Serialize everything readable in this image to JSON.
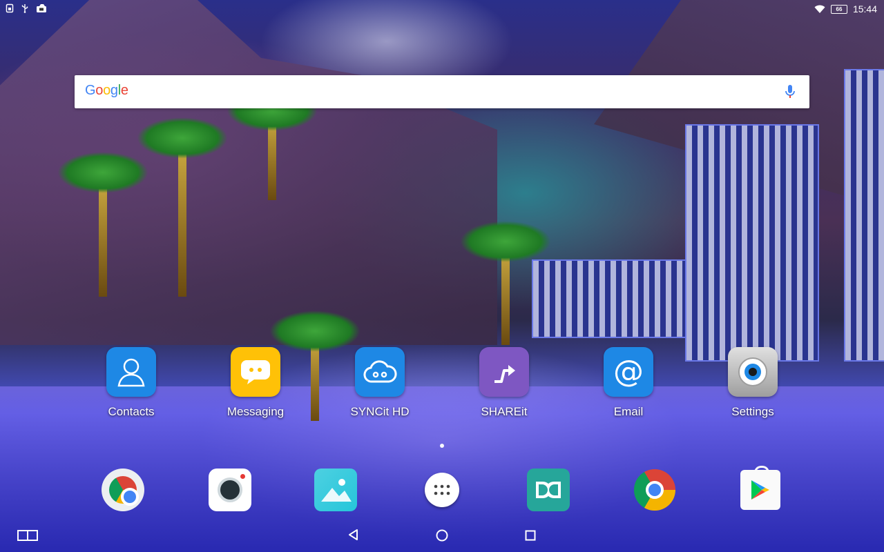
{
  "status_bar": {
    "time": "15:44",
    "battery": "66",
    "icons": [
      "sim-icon",
      "usb-icon",
      "screenshot-icon",
      "wifi-icon",
      "battery-icon"
    ]
  },
  "search": {
    "logo_text": "Google",
    "colors": [
      "#4285F4",
      "#EA4335",
      "#FBBC05",
      "#4285F4",
      "#34A853",
      "#EA4335"
    ],
    "mic_icon": "mic-icon"
  },
  "home": {
    "apps": [
      {
        "label": "Contacts",
        "icon": "contacts-icon",
        "color": "#1e88e5"
      },
      {
        "label": "Messaging",
        "icon": "messaging-icon",
        "color": "#ffc107"
      },
      {
        "label": "SYNCit HD",
        "icon": "cloud-sync-icon",
        "color": "#1e88e5"
      },
      {
        "label": "SHAREit",
        "icon": "shareit-icon",
        "color": "#7e57c2"
      },
      {
        "label": "Email",
        "icon": "at-sign-icon",
        "color": "#1e88e5"
      },
      {
        "label": "Settings",
        "icon": "gear-icon",
        "color": "#bdbdbd"
      }
    ],
    "page_indicator": {
      "pages": 2,
      "current": 1
    }
  },
  "dock": {
    "apps": [
      {
        "name": "chrome-folder",
        "icon": "chrome-icon"
      },
      {
        "name": "camera",
        "icon": "camera-icon"
      },
      {
        "name": "gallery",
        "icon": "gallery-icon"
      },
      {
        "name": "app-drawer",
        "icon": "app-drawer-icon"
      },
      {
        "name": "dolby",
        "icon": "dolby-icon"
      },
      {
        "name": "chrome",
        "icon": "chrome-icon"
      },
      {
        "name": "play-store",
        "icon": "play-store-icon"
      }
    ]
  },
  "nav_bar": {
    "buttons": [
      "multi-window-icon",
      "back-icon",
      "home-icon",
      "recents-icon"
    ]
  }
}
